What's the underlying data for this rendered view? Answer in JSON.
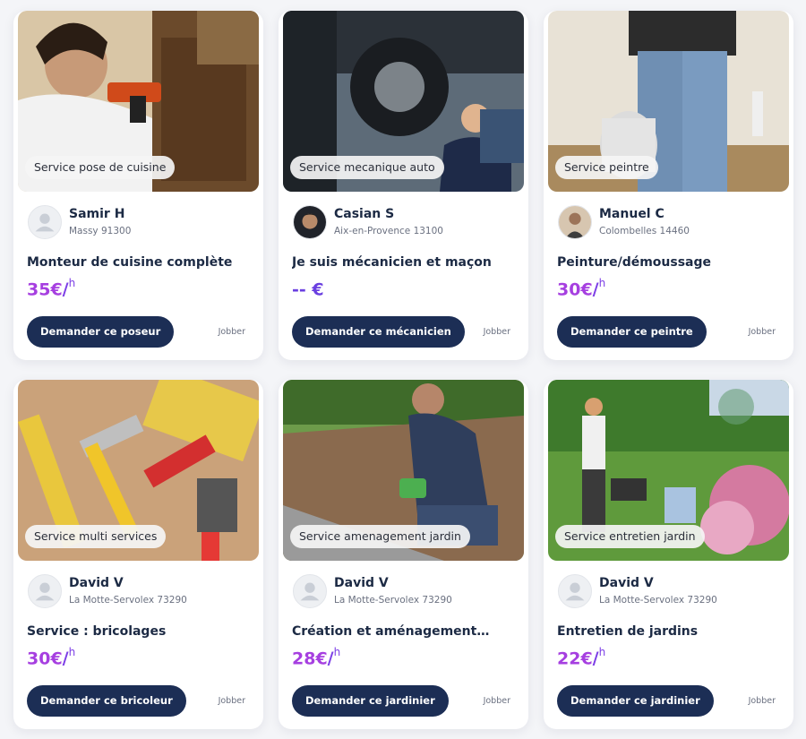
{
  "cards": [
    {
      "badge": "Service pose de cuisine",
      "name": "Samir H",
      "city": "Massy 91300",
      "title": "Monteur de cuisine complète",
      "price": "35€",
      "unit": "/",
      "unit_sup": "h",
      "button": "Demander ce poseur",
      "role": "Jobber",
      "image_icon": "kitchen-worker-photo",
      "avatar_icon": "default-avatar-icon"
    },
    {
      "badge": "Service mecanique auto",
      "name": "Casian S",
      "city": "Aix-en-Provence 13100",
      "title": "Je suis mécanicien et maçon",
      "price": "-- €",
      "unit": "",
      "unit_sup": "",
      "button": "Demander ce mécanicien",
      "role": "Jobber",
      "image_icon": "car-mechanic-photo",
      "avatar_icon": "user-photo-avatar"
    },
    {
      "badge": "Service peintre",
      "name": "Manuel C",
      "city": "Colombelles 14460",
      "title": "Peinture/démoussage",
      "price": "30€",
      "unit": "/",
      "unit_sup": "h",
      "button": "Demander ce peintre",
      "role": "Jobber",
      "image_icon": "painter-photo",
      "avatar_icon": "user-photo-avatar"
    },
    {
      "badge": "Service multi services",
      "name": "David V",
      "city": "La Motte-Servolex 73290",
      "title": "Service : bricolages",
      "price": "30€",
      "unit": "/",
      "unit_sup": "h",
      "button": "Demander ce bricoleur",
      "role": "Jobber",
      "image_icon": "tools-photo",
      "avatar_icon": "default-avatar-icon"
    },
    {
      "badge": "Service amenagement jardin",
      "name": "David V",
      "city": "La Motte-Servolex 73290",
      "title": "Création et aménagement…",
      "price": "28€",
      "unit": "/",
      "unit_sup": "h",
      "button": "Demander ce jardinier",
      "role": "Jobber",
      "image_icon": "garden-landscaping-photo",
      "avatar_icon": "default-avatar-icon"
    },
    {
      "badge": "Service entretien jardin",
      "name": "David V",
      "city": "La Motte-Servolex 73290",
      "title": "Entretien de jardins",
      "price": "22€",
      "unit": "/",
      "unit_sup": "h",
      "button": "Demander ce jardinier",
      "role": "Jobber",
      "image_icon": "lawn-mowing-photo",
      "avatar_icon": "default-avatar-icon"
    }
  ],
  "colors": {
    "price": "#a63fe0",
    "button_bg": "#1c2e55",
    "text_dark": "#1c2a44",
    "muted": "#6a7080"
  }
}
